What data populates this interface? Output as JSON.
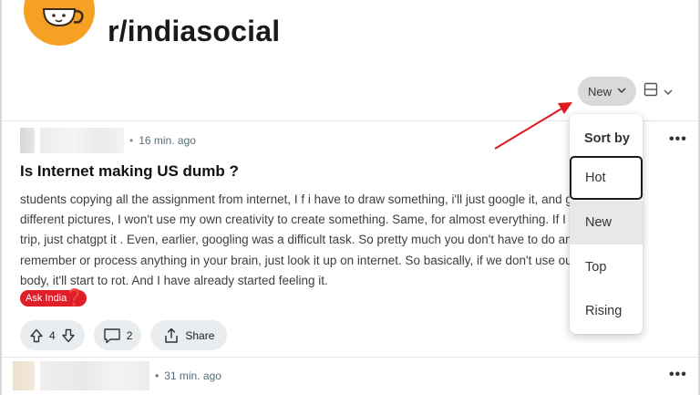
{
  "subreddit": {
    "name": "r/indiasocial",
    "avatar_icon": "tea-cup-face-icon",
    "avatar_color": "#f6a124"
  },
  "sort": {
    "current": "New",
    "menu_title": "Sort by",
    "options": [
      "Hot",
      "New",
      "Top",
      "Rising"
    ],
    "focused_option": "Hot",
    "highlighted_option": "New"
  },
  "view_toggle": {
    "icon": "layout-card-icon"
  },
  "post": {
    "time": "16 min. ago",
    "title": "Is Internet making US dumb ?",
    "body_lines": [
      "students copying all the assignment from internet, I f i have to draw something, i'll just google it, and get 1000s",
      "different pictures, I won't use my own creativity to create something. Same, for almost everything. If I have to plan",
      "trip, just chatgpt it . Even, earlier, googling was a difficult task. So pretty much you don't have to do anything ,",
      "remember or process anything in your brain, just look it up on internet. So basically, if we don't use our mind and",
      "body, it'll start to rot. And I have already started feeling it."
    ],
    "flair": "Ask India",
    "flair_color": "#e01e2a",
    "votes": "4",
    "comments": "2",
    "share_label": "Share"
  },
  "next_post": {
    "time": "31 min. ago"
  },
  "colors": {
    "annotation_arrow": "#e0191f",
    "control_bg": "#d9d9d9"
  }
}
